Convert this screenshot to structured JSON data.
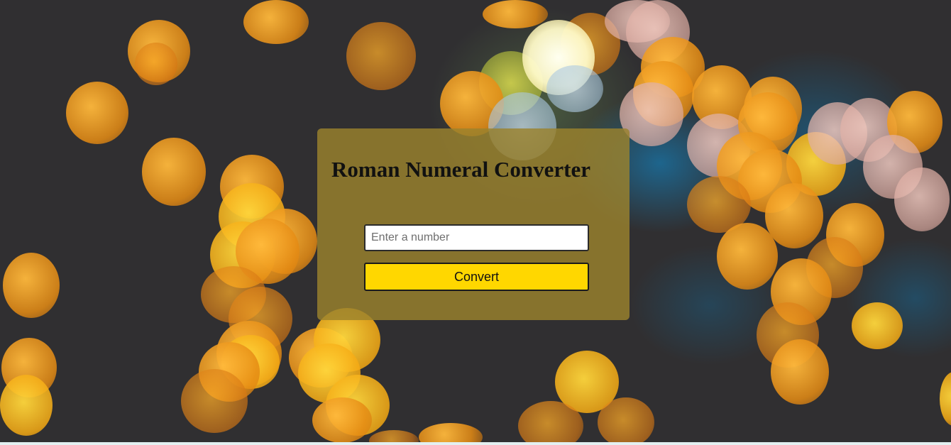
{
  "converter": {
    "title": "Roman Numeral Converter",
    "input_placeholder": "Enter a number",
    "input_value": "",
    "convert_label": "Convert"
  },
  "colors": {
    "card_background": "#9b822d",
    "button_background": "#ffd700",
    "page_background": "#302f31",
    "bottom_strip": "#e3f0f1"
  }
}
